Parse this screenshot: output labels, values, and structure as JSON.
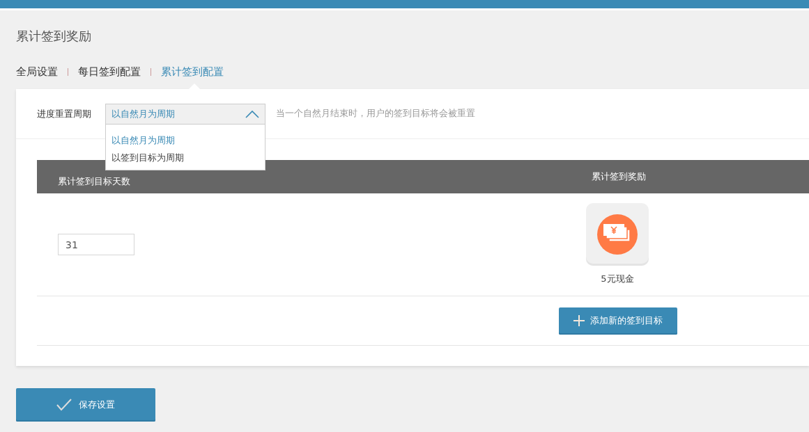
{
  "page_title": "累计签到奖励",
  "tabs": [
    {
      "label": "全局设置",
      "selected": false
    },
    {
      "label": "每日签到配置",
      "selected": false
    },
    {
      "label": "累计签到配置",
      "selected": true
    }
  ],
  "reset_period": {
    "label": "进度重置周期",
    "value": "以自然月为周期",
    "expanded": true,
    "options": [
      {
        "label": "以自然月为周期",
        "selected": true
      },
      {
        "label": "以签到目标为周期",
        "selected": false
      }
    ],
    "hint": "当一个自然月结束时，用户的签到目标将会被重置"
  },
  "table": {
    "columns": [
      "累计签到目标天数",
      "累计签到奖励"
    ],
    "rows": [
      {
        "days": "31",
        "reward": "5元现金"
      }
    ]
  },
  "add_button": "添加新的签到目标",
  "save_button": "保存设置"
}
